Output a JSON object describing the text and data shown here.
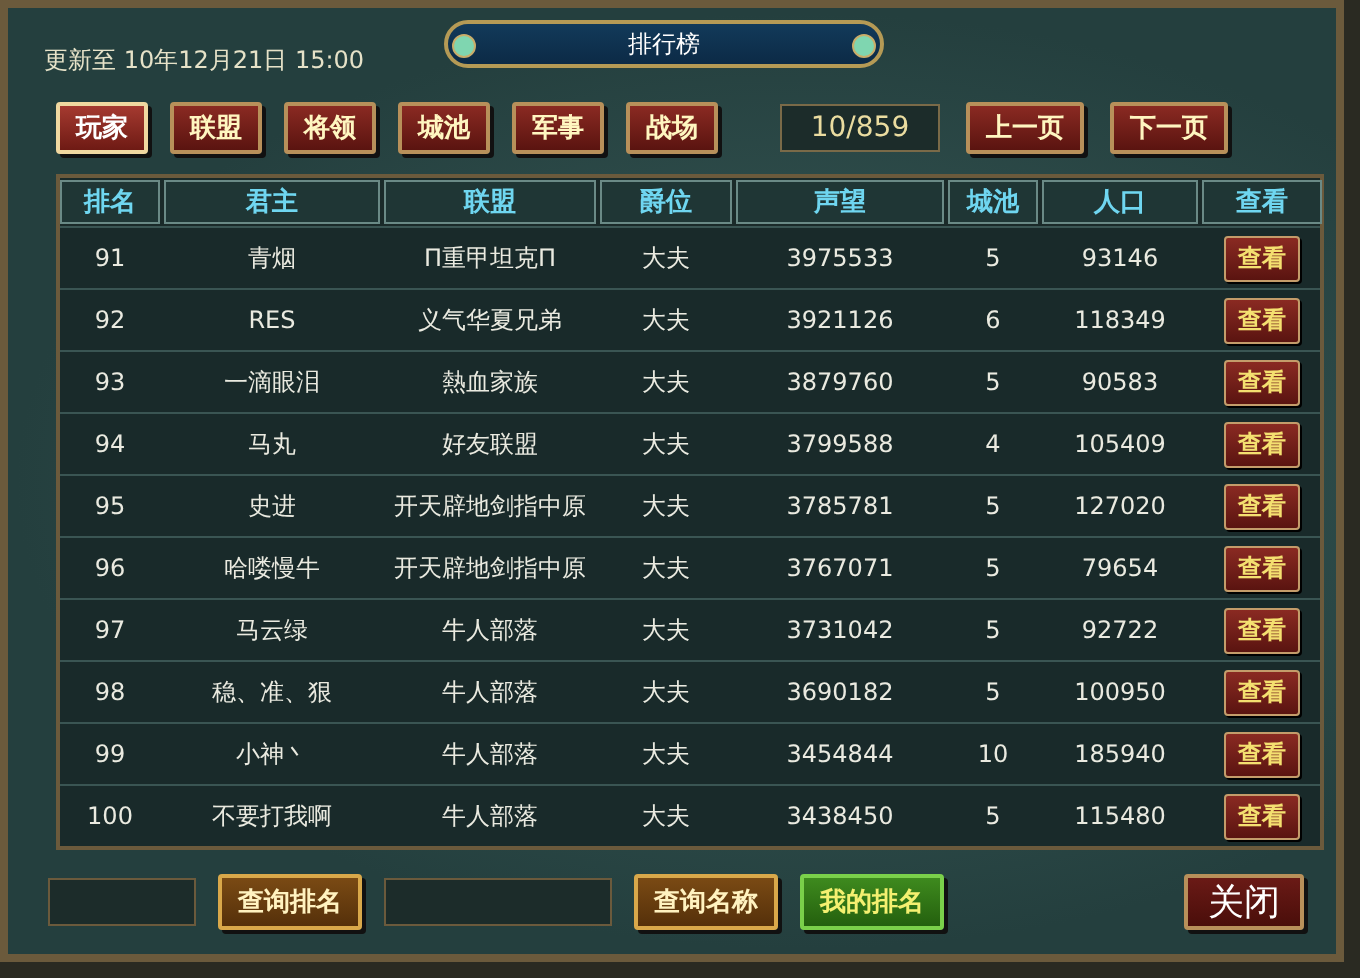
{
  "header": {
    "updated": "更新至 10年12月21日 15:00",
    "title": "排行榜"
  },
  "tabs": [
    {
      "label": "玩家",
      "selected": true
    },
    {
      "label": "联盟",
      "selected": false
    },
    {
      "label": "将领",
      "selected": false
    },
    {
      "label": "城池",
      "selected": false
    },
    {
      "label": "军事",
      "selected": false
    },
    {
      "label": "战场",
      "selected": false
    }
  ],
  "pager": {
    "page": "10/859",
    "prev": "上一页",
    "next": "下一页"
  },
  "table": {
    "columns": [
      "排名",
      "君主",
      "联盟",
      "爵位",
      "声望",
      "城池",
      "人口",
      "查看"
    ],
    "rows": [
      {
        "cells": [
          "91",
          "青烟",
          "Π重甲坦克Π",
          "大夫",
          "3975533",
          "5",
          "93146"
        ],
        "action": "查看"
      },
      {
        "cells": [
          "92",
          "RES",
          "义气华夏兄弟",
          "大夫",
          "3921126",
          "6",
          "118349"
        ],
        "action": "查看"
      },
      {
        "cells": [
          "93",
          "一滴眼泪",
          "熱血家族",
          "大夫",
          "3879760",
          "5",
          "90583"
        ],
        "action": "查看"
      },
      {
        "cells": [
          "94",
          "马丸",
          "好友联盟",
          "大夫",
          "3799588",
          "4",
          "105409"
        ],
        "action": "查看"
      },
      {
        "cells": [
          "95",
          "史进",
          "开天辟地剑指中原",
          "大夫",
          "3785781",
          "5",
          "127020"
        ],
        "action": "查看"
      },
      {
        "cells": [
          "96",
          "哈喽慢牛",
          "开天辟地剑指中原",
          "大夫",
          "3767071",
          "5",
          "79654"
        ],
        "action": "查看"
      },
      {
        "cells": [
          "97",
          "马云绿",
          "牛人部落",
          "大夫",
          "3731042",
          "5",
          "92722"
        ],
        "action": "查看"
      },
      {
        "cells": [
          "98",
          "稳、准、狠",
          "牛人部落",
          "大夫",
          "3690182",
          "5",
          "100950"
        ],
        "action": "查看"
      },
      {
        "cells": [
          "99",
          "小神丶",
          "牛人部落",
          "大夫",
          "3454844",
          "10",
          "185940"
        ],
        "action": "查看"
      },
      {
        "cells": [
          "100",
          "不要打我啊",
          "牛人部落",
          "大夫",
          "3438450",
          "5",
          "115480"
        ],
        "action": "查看"
      }
    ]
  },
  "footer": [
    {
      "kind": "field",
      "wide": false
    },
    {
      "kind": "gold",
      "label": "查询排名"
    },
    {
      "kind": "field",
      "wide": true
    },
    {
      "kind": "gold",
      "label": "查询名称"
    },
    {
      "kind": "green",
      "label": "我的排名"
    },
    {
      "kind": "close",
      "label": "关闭"
    }
  ]
}
